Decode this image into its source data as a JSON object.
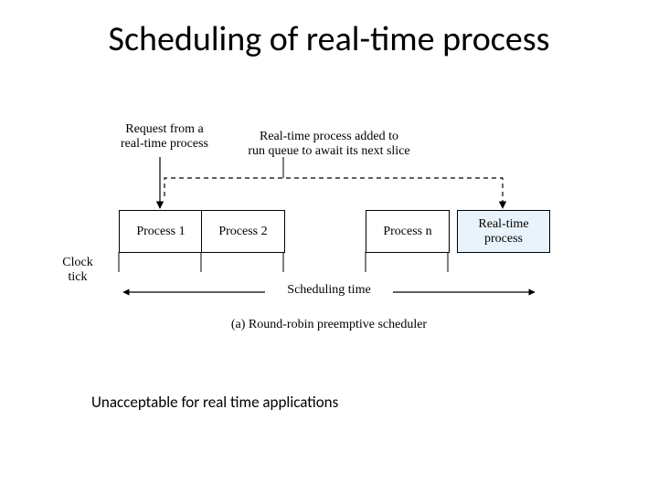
{
  "title": "Scheduling of real-time process",
  "diagram": {
    "request_label": "Request from a\nreal-time process",
    "added_label": "Real-time process added to\nrun queue to await its next slice",
    "boxes": {
      "p1": "Process 1",
      "p2": "Process 2",
      "pn": "Process n",
      "rt": "Real-time\nprocess"
    },
    "clock_tick": "Clock\ntick",
    "scheduling_time": "Scheduling time",
    "caption": "(a) Round-robin preemptive scheduler"
  },
  "note": "Unacceptable for real time applications"
}
